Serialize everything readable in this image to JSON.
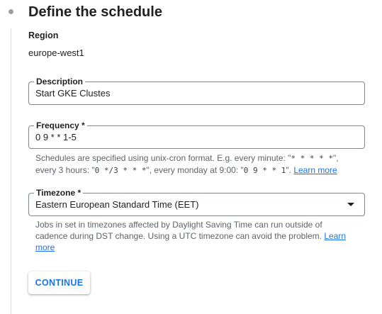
{
  "step": {
    "title": "Define the schedule"
  },
  "region": {
    "label": "Region",
    "value": "europe-west1"
  },
  "description": {
    "label": "Description",
    "value": "Start GKE Clustes"
  },
  "frequency": {
    "label": "Frequency *",
    "value": "0 9 * * 1-5",
    "hint_part1": "Schedules are specified using unix-cron format. E.g. every minute: \"",
    "code_minute": "* * * * *",
    "hint_part2": "\",",
    "hint_part3": "every 3 hours: \"",
    "code_3hours": "0 */3 * * *",
    "hint_part4": "\", every monday at 9:00: \"",
    "code_monday": "0 9 * * 1",
    "hint_part5": "\". ",
    "learn_more": "Learn more"
  },
  "timezone": {
    "label": "Timezone *",
    "value": "Eastern European Standard Time (EET)",
    "hint_line1": "Jobs in set in timezones affected by Daylight Saving Time can run outside of",
    "hint_line2": "cadence during DST change. Using a UTC timezone can avoid the problem.",
    "learn_more_a": "Learn",
    "learn_more_b": "more"
  },
  "actions": {
    "continue_label": "CONTINUE"
  },
  "colors": {
    "accent": "#1a73e8",
    "border": "#80868b",
    "hint": "#5f6368"
  }
}
